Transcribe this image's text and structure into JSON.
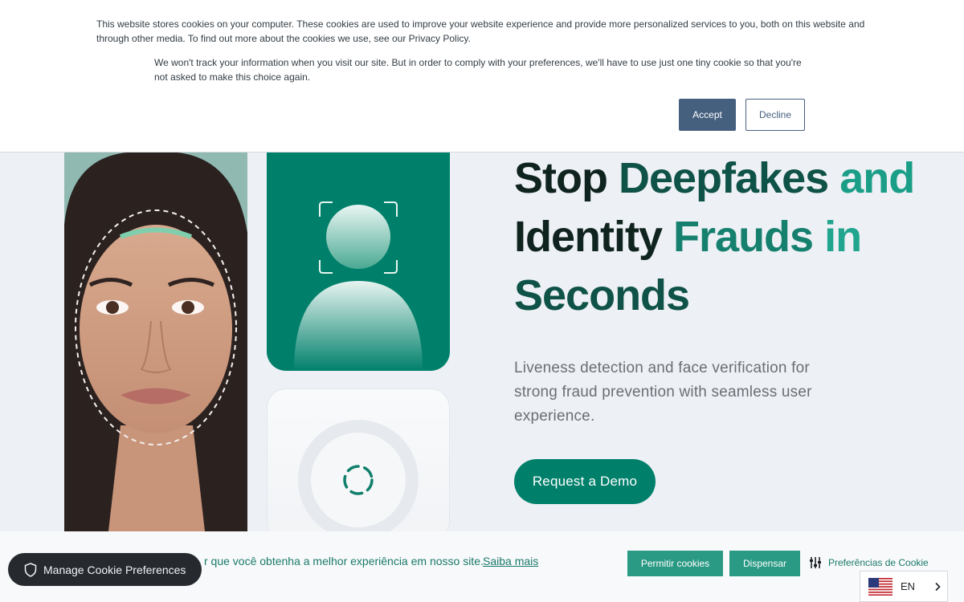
{
  "cookie_banner": {
    "paragraph_1": "This website stores cookies on your computer. These cookies are used to improve your website experience and provide more personalized services to you, both on this website and through other media. To find out more about the cookies we use, see our Privacy Policy.",
    "paragraph_2": "We won't track your information when you visit our site. But in order to comply with your preferences, we'll have to use just one tiny cookie so that you're not asked to make this choice again.",
    "accept_label": "Accept",
    "decline_label": "Decline"
  },
  "hero": {
    "headline_words": [
      "Stop",
      "Deepfakes",
      "and",
      "Identity",
      "Frauds",
      "in",
      "Seconds"
    ],
    "subtitle": "Liveness detection and face verification for strong fraud prevention with seamless user experience.",
    "cta_label": "Request a Demo"
  },
  "consent_bar": {
    "text": "r que você obtenha a melhor experiência em nosso site.",
    "learn_more": "Saiba mais",
    "allow_label": "Permitir cookies",
    "dismiss_label": "Dispensar",
    "preferences_label": "Preferências de Cookie"
  },
  "manage_cookies": {
    "label": "Manage Cookie Preferences"
  },
  "language": {
    "code": "EN",
    "flag": "us-flag-icon"
  },
  "colors": {
    "brand_green": "#00806b",
    "accept_button": "#45607f",
    "consent_button": "#2b9a85",
    "manage_pill": "#262a2e"
  }
}
